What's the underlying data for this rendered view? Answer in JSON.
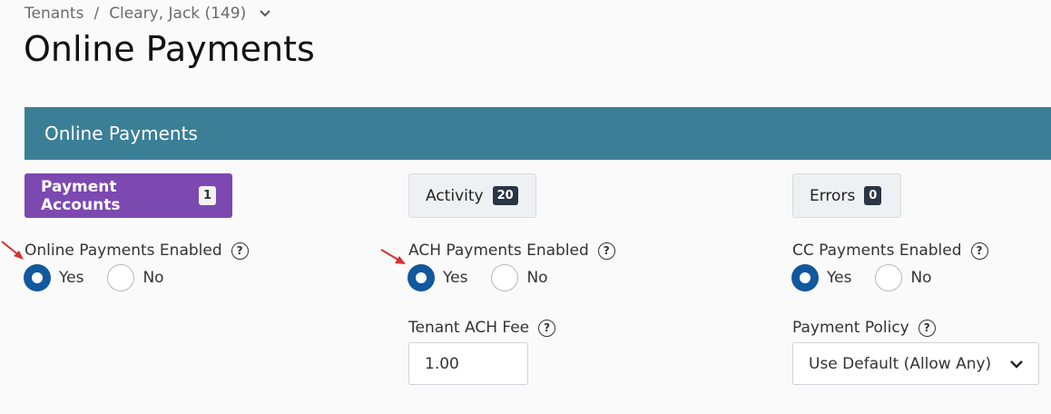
{
  "breadcrumb": {
    "root": "Tenants",
    "separator": "/",
    "current": "Cleary, Jack (149)"
  },
  "page_title": "Online Payments",
  "banner": {
    "title": "Online Payments"
  },
  "tabs": {
    "payment_accounts": {
      "label": "Payment Accounts",
      "count": "1"
    },
    "activity": {
      "label": "Activity",
      "count": "20"
    },
    "errors": {
      "label": "Errors",
      "count": "0"
    }
  },
  "online_payments": {
    "label": "Online Payments Enabled",
    "yes": "Yes",
    "no": "No",
    "selected": "Yes"
  },
  "ach_payments": {
    "label": "ACH Payments Enabled",
    "yes": "Yes",
    "no": "No",
    "selected": "Yes"
  },
  "cc_payments": {
    "label": "CC Payments Enabled",
    "yes": "Yes",
    "no": "No",
    "selected": "Yes"
  },
  "tenant_ach_fee": {
    "label": "Tenant ACH Fee",
    "value": "1.00"
  },
  "payment_policy": {
    "label": "Payment Policy",
    "value": "Use Default (Allow Any)"
  },
  "colors": {
    "banner": "#3b7f97",
    "primary_button": "#7c49b0",
    "radio_selected": "#11589d",
    "annotation_arrow": "#d9302c"
  },
  "icons": {
    "help": "question-circle-icon",
    "dropdown": "chevron-down-icon"
  }
}
